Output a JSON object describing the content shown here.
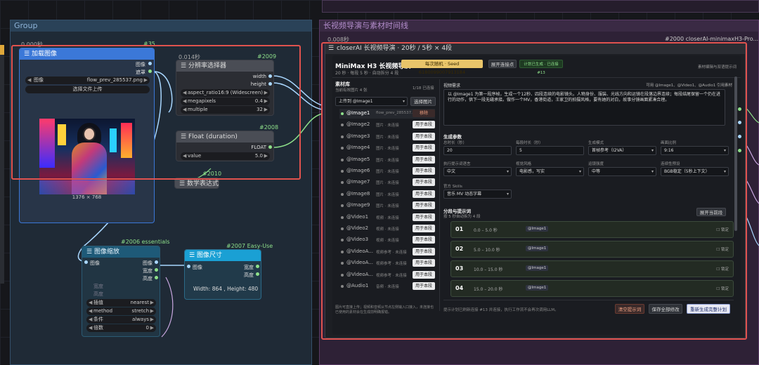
{
  "groups": {
    "left_title": "Group",
    "right_title": "长视频导演与素材时间线"
  },
  "node_35": {
    "id": "#35",
    "time": "0.000秒",
    "title": "加载图像",
    "out_image": "图像",
    "out_mask": "遮罩",
    "file_label": "图像",
    "file_value": "flow_prev_285537.png",
    "upload_label": "选择文件上传",
    "size_caption": "1376 × 768"
  },
  "node_2009": {
    "id": "#2009",
    "time": "0.014秒",
    "title": "分辨率选择器",
    "out_width": "width",
    "out_height": "height",
    "aspect_label": "aspect_ratio",
    "aspect_value": "16:9 (Widescreen)",
    "mp_label": "megapixels",
    "mp_value": "0.4",
    "mult_label": "multiple",
    "mult_value": "32"
  },
  "node_2008": {
    "id": "#2008",
    "title": "Float (duration)",
    "out_type": "FLOAT",
    "value_label": "value",
    "value": "5.0"
  },
  "node_2010": {
    "id": "#2010",
    "title": "数学表达式"
  },
  "node_2006": {
    "id": "#2006 essentials",
    "title": "图像缩放",
    "in_image": "图像",
    "out_image": "图像",
    "out_width": "宽度",
    "out_height": "高度",
    "in_width": "宽度",
    "in_height": "高度",
    "interp_label": "插值",
    "interp_value": "nearest",
    "method_label": "method",
    "method_value": "stretch",
    "cond_label": "条件",
    "cond_value": "always",
    "mult_label": "倍数",
    "mult_value": "0"
  },
  "node_2007": {
    "id": "#2007 Easy-Use",
    "title": "图像尺寸",
    "in_image": "图像",
    "out_width": "宽度",
    "out_height": "高度",
    "result": "Width: 864 , Height: 480"
  },
  "node_2000": {
    "time": "0.008秒",
    "id_title": "#2000 closerAI-minimaxH3-Pro...",
    "panel_title": "closerAI 长视频导演 · 20秒 / 5秒 × 4段",
    "app_title": "MiniMax H3 长视频导演",
    "seed_badge": "每次随机 · Seed 6180099007913184",
    "expand_button": "展开连接点",
    "sync_badge": "计划已生成 · 已连接 #13",
    "subtitle": "20 秒 · 每段 5 秒 · 自动拆分 4 段",
    "right_note": "素材编辑与双语提示词",
    "library_title": "素材库",
    "library_sub": "当前有效图片 4 张",
    "library_count": "1/18 已连接",
    "upload_select": "上传到 @Image1",
    "choose_image": "选择图片",
    "assets": [
      {
        "name": "@Image1",
        "status": "flow_prev_285537.png",
        "action": "移除"
      },
      {
        "name": "@Image2",
        "status": "图片 · 未连接",
        "action": "用于本段"
      },
      {
        "name": "@Image3",
        "status": "图片 · 未连接",
        "action": "用于本段"
      },
      {
        "name": "@Image4",
        "status": "图片 · 未连接",
        "action": "用于本段"
      },
      {
        "name": "@Image5",
        "status": "图片 · 未连接",
        "action": "用于本段"
      },
      {
        "name": "@Image6",
        "status": "图片 · 未连接",
        "action": "用于本段"
      },
      {
        "name": "@Image7",
        "status": "图片 · 未连接",
        "action": "用于本段"
      },
      {
        "name": "@Image8",
        "status": "图片 · 未连接",
        "action": "用于本段"
      },
      {
        "name": "@Image9",
        "status": "图片 · 未连接",
        "action": "用于本段"
      },
      {
        "name": "@Video1",
        "status": "视频 · 未连接",
        "action": "用于本段"
      },
      {
        "name": "@Video2",
        "status": "视频 · 未连接",
        "action": "用于本段"
      },
      {
        "name": "@Video3",
        "status": "视频 · 未连接",
        "action": "用于本段"
      },
      {
        "name": "@VideoA...",
        "status": "视频参考 · 未连接",
        "action": "用于本段"
      },
      {
        "name": "@VideoA...",
        "status": "视频参考 · 未连接",
        "action": "用于本段"
      },
      {
        "name": "@VideoA...",
        "status": "视频参考 · 未连接",
        "action": "用于本段"
      },
      {
        "name": "@Audio1",
        "status": "音频 · 未连接",
        "action": "用于本段"
      }
    ],
    "library_footer": "图片可直接上传；视频和音频从节点左侧输入口接入，未连接也已使用的素材会在生成前明确报错。",
    "request_label": "视频需求",
    "available_refs": "可用 @Image1、@Video1、@Audio1 引用素材",
    "request_text": "以 @Image1 为第一段序帧，生成一个12秒、四段连续的电影镜头。人物身份、服装、光线方向和运镜在段落边界连续；每段结尾保留一个仍在进行的动作，供下一段无缝承接。做作一个MV，香港街道，王家卫的拍摄风格，要有她的对白，故事分镜画面紧凑合理。",
    "params_title": "生成参数",
    "params": [
      {
        "label": "总时长（秒）",
        "value": "20"
      },
      {
        "label": "每段时长（秒）",
        "value": "5"
      },
      {
        "label": "生成模式",
        "value": "首帧参考（I2VA）"
      },
      {
        "label": "画面比例",
        "value": "9:16"
      },
      {
        "label": "执行提示词语言",
        "value": "中文"
      },
      {
        "label": "视觉风格",
        "value": "电影感，写实"
      },
      {
        "label": "运镜强度",
        "value": "中等"
      },
      {
        "label": "连续性预设",
        "value": "BGB稳定（5秒上下文）"
      }
    ],
    "skills_label": "官方 Skills",
    "skills_value": "音乐 MV 动态字幕",
    "segments_title": "分段与提示词",
    "segments_sub": "按 5 秒自动拆为 4 段",
    "expand_prompts": "展开当前段",
    "segments": [
      {
        "num": "01",
        "range": "0.0 – 5.0 秒",
        "image": "@Image1",
        "lock": "锁定"
      },
      {
        "num": "02",
        "range": "5.0 – 10.0 秒",
        "image": "@Image1",
        "lock": "锁定"
      },
      {
        "num": "03",
        "range": "10.0 – 15.0 秒",
        "image": "@Image1",
        "lock": "锁定"
      },
      {
        "num": "04",
        "range": "15.0 – 20.0 秒",
        "image": "@Image1",
        "lock": "锁定"
      }
    ],
    "footer_note": "提示计划已刷新连接 #13 并连接，执行工作流不会再次调用LLM。",
    "clear_button": "清空提示词",
    "save_button": "保存全部修改",
    "regen_button": "重新生成完整计划"
  }
}
